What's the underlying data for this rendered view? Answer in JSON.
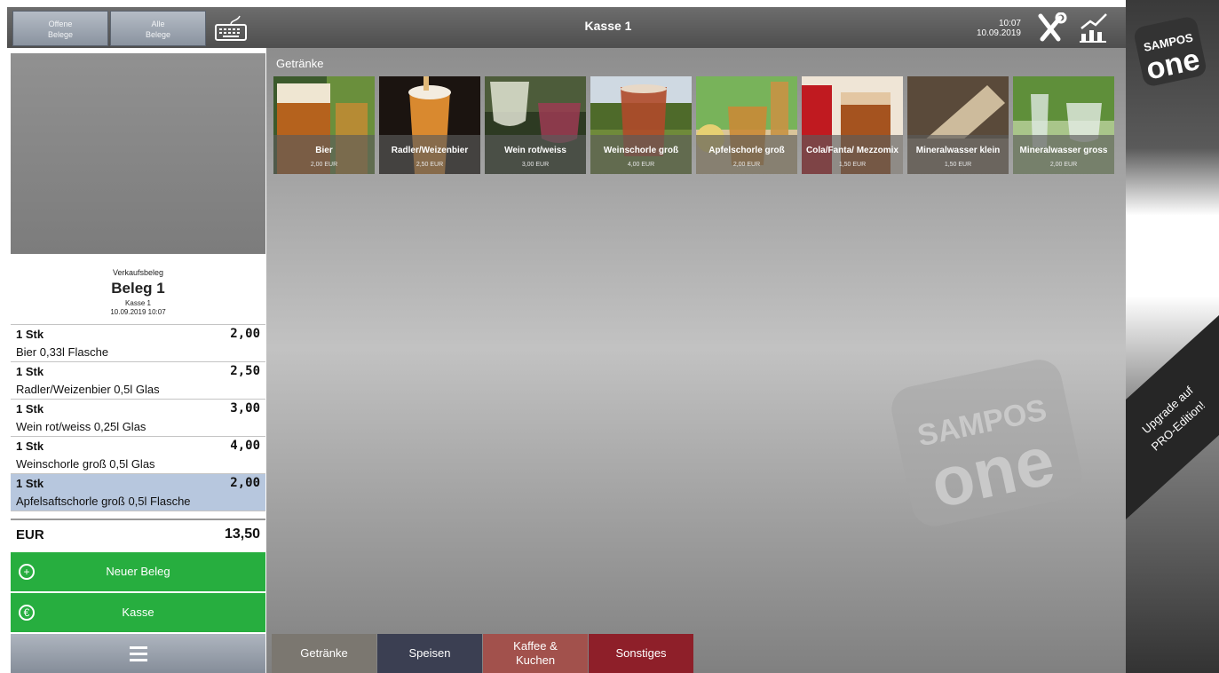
{
  "header": {
    "open_receipts": [
      "Offene",
      "Belege"
    ],
    "all_receipts": [
      "Alle",
      "Belege"
    ],
    "title": "Kasse 1",
    "time": "10:07",
    "date": "10.09.2019"
  },
  "category_title": "Getränke",
  "products": [
    {
      "name": "Bier",
      "price": "2,00 EUR"
    },
    {
      "name": "Radler/Weizenbier",
      "price": "2,50 EUR"
    },
    {
      "name": "Wein rot/weiss",
      "price": "3,00 EUR"
    },
    {
      "name": "Weinschorle groß",
      "price": "4,00 EUR"
    },
    {
      "name": "Apfelschorle groß",
      "price": "2,00 EUR"
    },
    {
      "name": "Cola/Fanta/ Mezzomix",
      "price": "1,50 EUR"
    },
    {
      "name": "Mineralwasser klein",
      "price": "1,50 EUR"
    },
    {
      "name": "Mineralwasser gross",
      "price": "2,00 EUR"
    }
  ],
  "receipt": {
    "type": "Verkaufsbeleg",
    "title": "Beleg 1",
    "register": "Kasse 1",
    "datetime": "10.09.2019 10:07",
    "items": [
      {
        "qty": "1 Stk",
        "price": "2,00",
        "name": "Bier 0,33l Flasche"
      },
      {
        "qty": "1 Stk",
        "price": "2,50",
        "name": "Radler/Weizenbier 0,5l Glas"
      },
      {
        "qty": "1 Stk",
        "price": "3,00",
        "name": "Wein rot/weiss 0,25l Glas"
      },
      {
        "qty": "1 Stk",
        "price": "4,00",
        "name": "Weinschorle groß 0,5l Glas"
      },
      {
        "qty": "1 Stk",
        "price": "2,00",
        "name": "Apfelsaftschorle groß 0,5l Flasche"
      }
    ],
    "currency": "EUR",
    "total": "13,50"
  },
  "actions": {
    "new_receipt": "Neuer Beleg",
    "checkout": "Kasse"
  },
  "tabs": [
    {
      "label": "Getränke",
      "color": "#7b7770"
    },
    {
      "label": "Speisen",
      "color": "#3b3f52"
    },
    {
      "label": "Kaffee & Kuchen",
      "color": "#a2514c"
    },
    {
      "label": "Sonstiges",
      "color": "#8e1f29"
    }
  ],
  "branding": {
    "logo_top": "SAMPOS",
    "logo_bottom": "one",
    "upgrade_line1": "Upgrade auf",
    "upgrade_line2": "PRO-Edition!"
  },
  "colors": {
    "green": "#27ae3f",
    "selected_row": "#b7c7de"
  }
}
